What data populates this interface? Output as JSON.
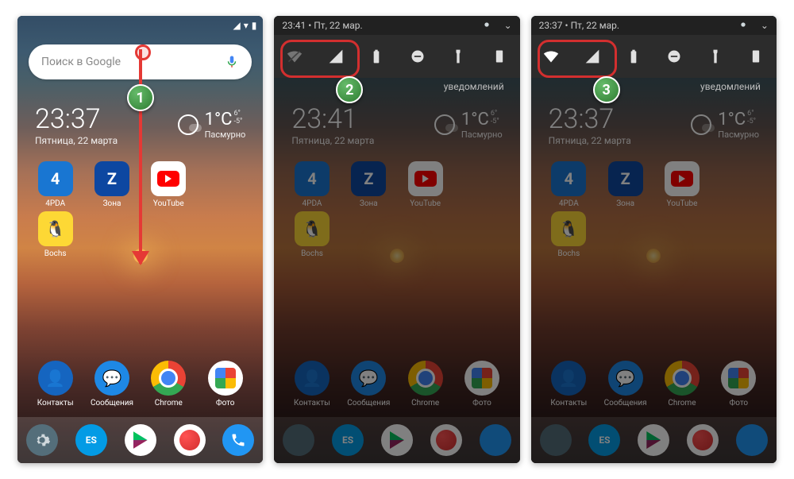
{
  "panel1": {
    "search_placeholder": "Поиск в Google",
    "time": "23:37",
    "date": "Пятница, 22 марта",
    "temp": "1°C",
    "temp_high": "6°",
    "temp_low": "-5°",
    "condition": "Пасмурно",
    "apps": [
      "4PDA",
      "Зона",
      "YouTube",
      "Bochs"
    ],
    "dock": [
      "Контакты",
      "Сообщения",
      "Chrome",
      "Фото"
    ],
    "badge": "1"
  },
  "panel2": {
    "shade_time": "23:41",
    "shade_date": "Пт, 22 мар.",
    "notif_hint": "уведомлений",
    "time": "23:41",
    "date": "Пятница, 22 марта",
    "temp": "1°C",
    "temp_high": "6°",
    "temp_low": "-5°",
    "condition": "Пасмурно",
    "apps": [
      "4PDA",
      "Зона",
      "YouTube",
      "Bochs"
    ],
    "dock": [
      "Контакты",
      "Сообщения",
      "Chrome",
      "Фото"
    ],
    "badge": "2",
    "wifi_on": false
  },
  "panel3": {
    "shade_time": "23:37",
    "shade_date": "Пт, 22 мар.",
    "notif_hint": "уведомлений",
    "time": "23:37",
    "date": "Пятница, 22 марта",
    "temp": "1°C",
    "temp_high": "6°",
    "temp_low": "-5°",
    "condition": "Пасмурно",
    "apps": [
      "4PDA",
      "Зона",
      "YouTube",
      "Bochs"
    ],
    "dock": [
      "Контакты",
      "Сообщения",
      "Chrome",
      "Фото"
    ],
    "badge": "3",
    "wifi_on": true
  }
}
